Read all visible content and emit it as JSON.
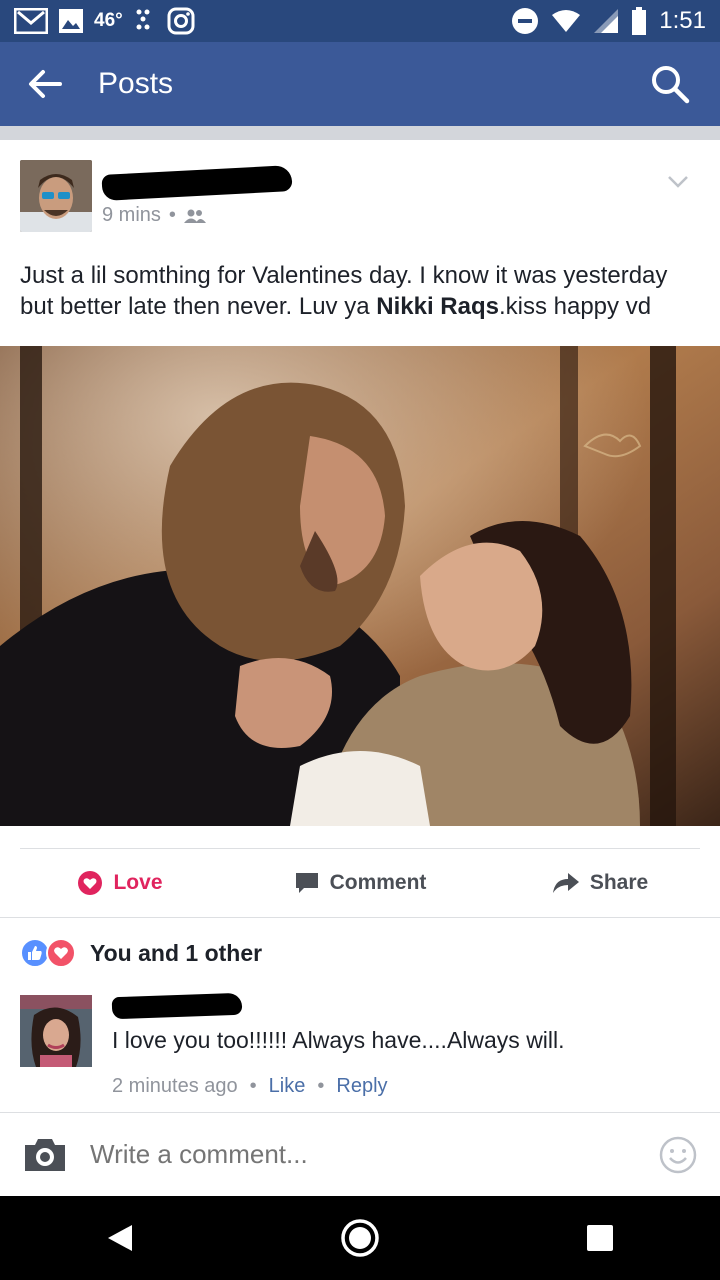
{
  "status_bar": {
    "temperature": "46°",
    "time": "1:51"
  },
  "app_bar": {
    "title": "Posts"
  },
  "post": {
    "time": "9 mins",
    "text_before": "Just a lil somthing for Valentines day. I know it was yesterday but better late then never. Luv ya ",
    "tagged": "Nikki Raqs",
    "text_after": ".kiss happy vd"
  },
  "actions": {
    "love": "Love",
    "comment": "Comment",
    "share": "Share"
  },
  "reactions": {
    "summary": "You and 1 other"
  },
  "comment": {
    "text": "I love you too!!!!!! Always have....Always will.",
    "time": "2 minutes ago",
    "like": "Like",
    "reply": "Reply"
  },
  "composer": {
    "placeholder": "Write a comment..."
  },
  "colors": {
    "brand": "#3b5998",
    "status": "#29487d",
    "love": "#e0245e",
    "like": "#5890ff"
  }
}
